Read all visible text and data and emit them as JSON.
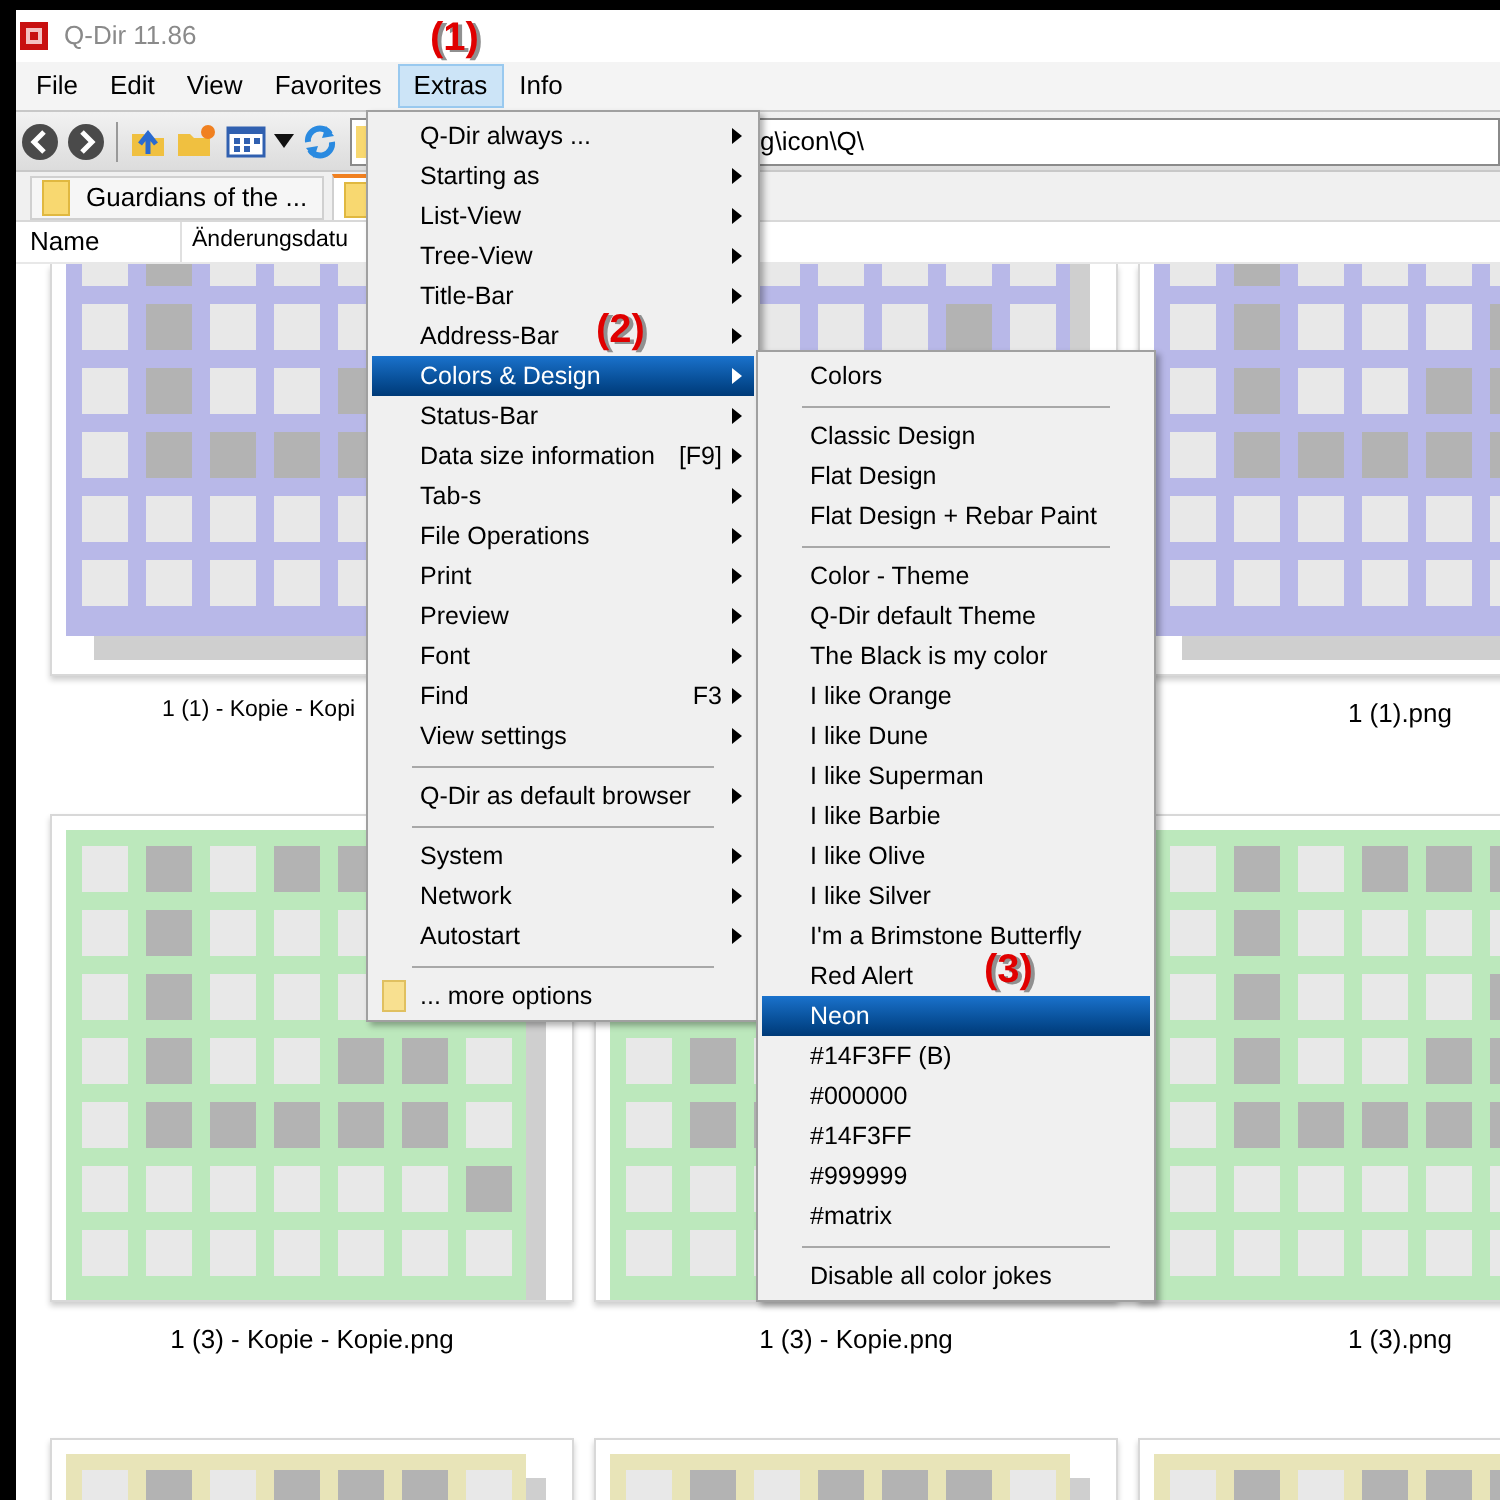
{
  "window": {
    "title": "Q-Dir 11.86"
  },
  "menu_bar": [
    {
      "label": "File",
      "selected": false
    },
    {
      "label": "Edit",
      "selected": false
    },
    {
      "label": "View",
      "selected": false
    },
    {
      "label": "Favorites",
      "selected": false
    },
    {
      "label": "Extras",
      "selected": true
    },
    {
      "label": "Info",
      "selected": false
    }
  ],
  "address_bar": {
    "value": "g\\icon\\Q\\"
  },
  "tabs": [
    {
      "label": "Guardians of the ...",
      "selected": false
    },
    {
      "selected": true
    }
  ],
  "columns": [
    "Name",
    "Änderungsdatu"
  ],
  "thumbnail_rows": [
    {
      "color": "#b8b8e8",
      "items": [
        {
          "kind": "image",
          "label": "1 (1) - Kopie - Kopi",
          "cut": true
        },
        {
          "kind": "image"
        },
        {
          "kind": "image",
          "label": "1 (1).png"
        }
      ]
    },
    {
      "color": "#bce8bc",
      "items": [
        {
          "kind": "image",
          "label": "1 (3) - Kopie - Kopie.png"
        },
        {
          "kind": "image",
          "label": "1 (3) - Kopie.png"
        },
        {
          "kind": "image",
          "label": "1 (3).png"
        }
      ]
    },
    {
      "color": "#e8e4b8",
      "items": [
        {
          "kind": "image"
        },
        {
          "kind": "image"
        },
        {
          "kind": "image"
        }
      ]
    }
  ],
  "extras_menu": [
    {
      "kind": "item",
      "label": "Q-Dir always ...",
      "submenu": true,
      "selected": false
    },
    {
      "kind": "item",
      "label": "Starting as",
      "submenu": true,
      "selected": false
    },
    {
      "kind": "item",
      "label": "List-View",
      "submenu": true,
      "selected": false
    },
    {
      "kind": "item",
      "label": "Tree-View",
      "submenu": true,
      "selected": false
    },
    {
      "kind": "item",
      "label": "Title-Bar",
      "submenu": true,
      "selected": false
    },
    {
      "kind": "item",
      "label": "Address-Bar",
      "submenu": true,
      "selected": false
    },
    {
      "kind": "item",
      "label": "Colors & Design",
      "submenu": true,
      "selected": true
    },
    {
      "kind": "item",
      "label": "Status-Bar",
      "submenu": true,
      "selected": false
    },
    {
      "kind": "item",
      "label": "Data size information",
      "shortcut": "[F9]",
      "submenu": true,
      "selected": false
    },
    {
      "kind": "item",
      "label": "Tab-s",
      "submenu": true,
      "selected": false
    },
    {
      "kind": "item",
      "label": "File Operations",
      "submenu": true,
      "selected": false
    },
    {
      "kind": "item",
      "label": "Print",
      "submenu": true,
      "selected": false
    },
    {
      "kind": "item",
      "label": "Preview",
      "submenu": true,
      "selected": false
    },
    {
      "kind": "item",
      "label": "Font",
      "submenu": true,
      "selected": false
    },
    {
      "kind": "item",
      "label": "Find",
      "shortcut": "F3",
      "submenu": true,
      "selected": false
    },
    {
      "kind": "item",
      "label": "View settings",
      "submenu": true,
      "selected": false
    },
    {
      "kind": "separator"
    },
    {
      "kind": "item",
      "label": "Q-Dir as default browser",
      "submenu": true,
      "selected": false
    },
    {
      "kind": "separator"
    },
    {
      "kind": "item",
      "label": "System",
      "submenu": true,
      "selected": false
    },
    {
      "kind": "item",
      "label": "Network",
      "submenu": true,
      "selected": false
    },
    {
      "kind": "item",
      "label": "Autostart",
      "submenu": true,
      "selected": false
    },
    {
      "kind": "separator"
    },
    {
      "kind": "folder",
      "label": "... more options",
      "submenu": false,
      "selected": false
    }
  ],
  "colors_design_menu": [
    {
      "kind": "item",
      "label": "Colors",
      "selected": false
    },
    {
      "kind": "separator"
    },
    {
      "kind": "item",
      "label": "Classic Design",
      "selected": false
    },
    {
      "kind": "item",
      "label": "Flat Design",
      "selected": false
    },
    {
      "kind": "item",
      "label": "Flat Design + Rebar Paint",
      "selected": false
    },
    {
      "kind": "separator"
    },
    {
      "kind": "item",
      "label": "Color - Theme",
      "selected": false
    },
    {
      "kind": "item",
      "label": "Q-Dir default Theme",
      "selected": false
    },
    {
      "kind": "item",
      "label": "The Black is my color",
      "selected": false
    },
    {
      "kind": "item",
      "label": "I like Orange",
      "selected": false
    },
    {
      "kind": "item",
      "label": "I like Dune",
      "selected": false
    },
    {
      "kind": "item",
      "label": "I like Superman",
      "selected": false
    },
    {
      "kind": "item",
      "label": "I like Barbie",
      "selected": false
    },
    {
      "kind": "item",
      "label": "I like Olive",
      "selected": false
    },
    {
      "kind": "item",
      "label": "I like Silver",
      "selected": false
    },
    {
      "kind": "item",
      "label": "I'm a Brimstone Butterfly",
      "selected": false
    },
    {
      "kind": "item",
      "label": "Red Alert",
      "selected": false
    },
    {
      "kind": "item",
      "label": "Neon",
      "selected": true
    },
    {
      "kind": "item",
      "label": "#14F3FF (B)",
      "selected": false
    },
    {
      "kind": "item",
      "label": "#000000",
      "selected": false
    },
    {
      "kind": "item",
      "label": "#14F3FF",
      "selected": false
    },
    {
      "kind": "item",
      "label": "#999999",
      "selected": false
    },
    {
      "kind": "item",
      "label": "#matrix",
      "selected": false
    },
    {
      "kind": "separator"
    },
    {
      "kind": "item",
      "label": "Disable all color jokes",
      "selected": false
    }
  ],
  "annotations": [
    "(1)",
    "(2)",
    "(3)"
  ]
}
